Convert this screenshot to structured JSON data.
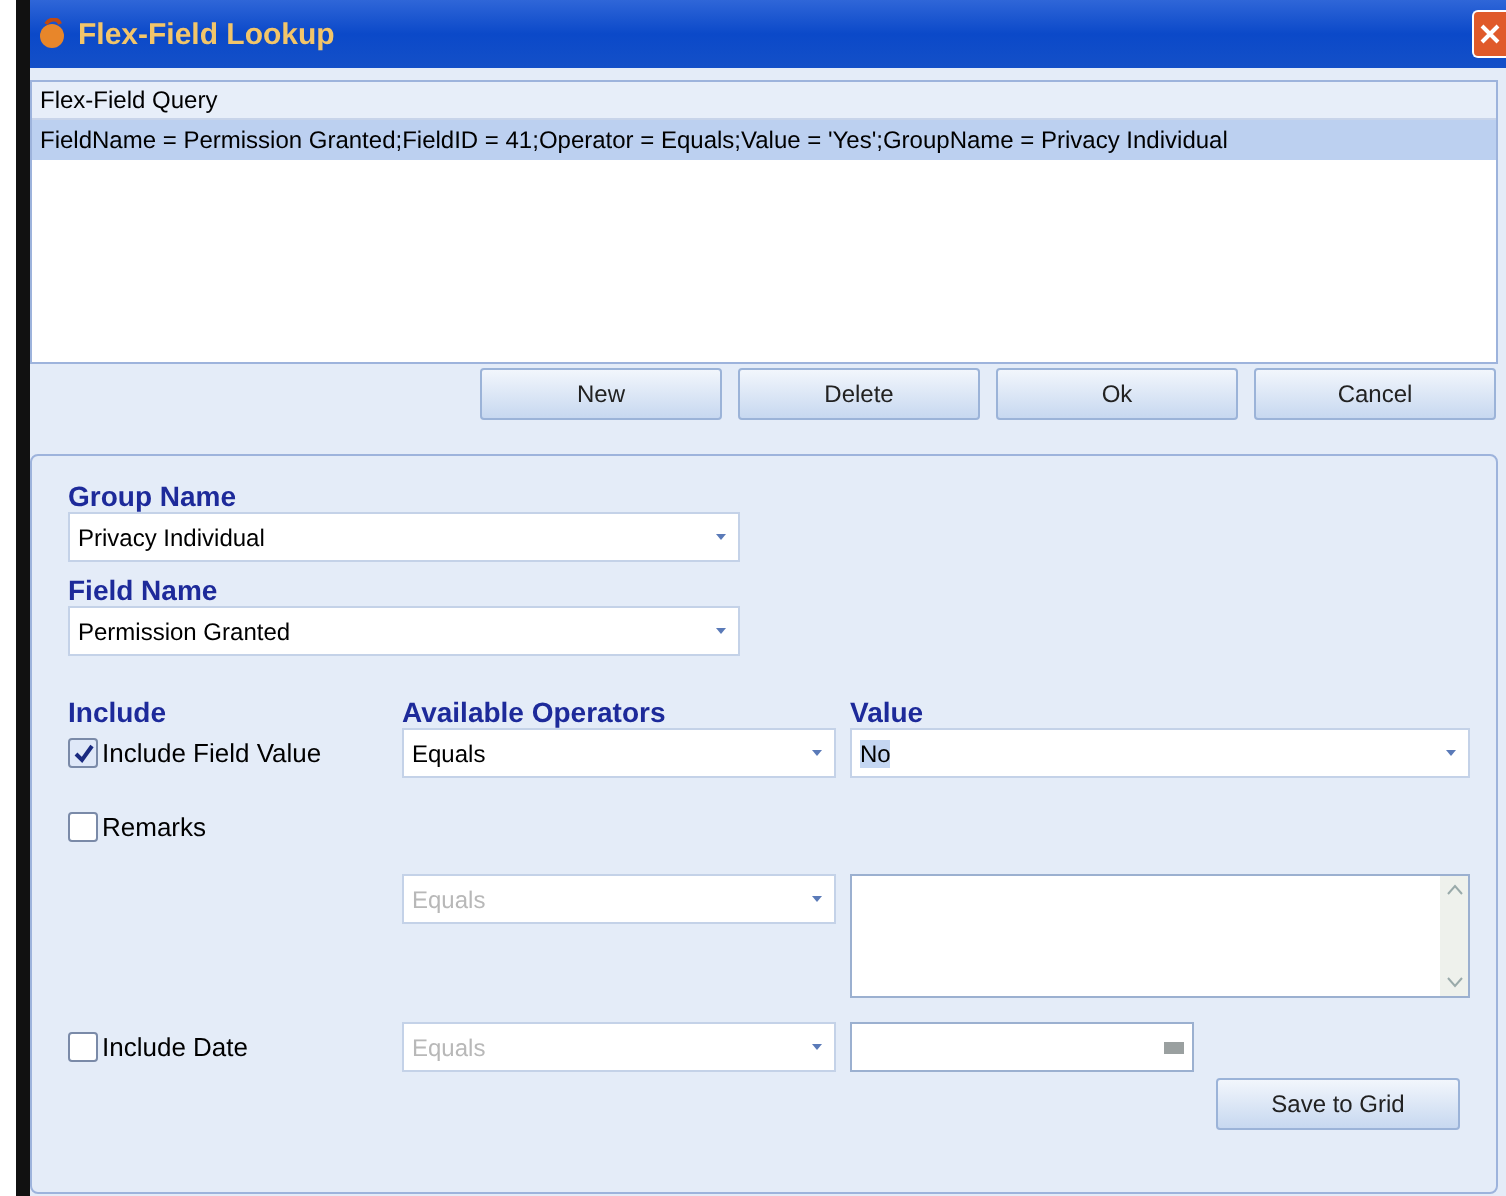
{
  "window": {
    "title": "Flex-Field Lookup"
  },
  "grid": {
    "header": "Flex-Field Query",
    "rows": [
      {
        "text": "FieldName = Permission Granted;FieldID = 41;Operator = Equals;Value = 'Yes';GroupName = Privacy Individual",
        "selected": true
      }
    ]
  },
  "buttons": [
    "New",
    "Delete",
    "Ok",
    "Cancel"
  ],
  "group_name": {
    "label": "Group Name",
    "value": "Privacy Individual"
  },
  "field_name": {
    "label": "Field Name",
    "value": "Permission Granted"
  },
  "headers": {
    "include": "Include",
    "operators": "Available Operators",
    "value": "Value"
  },
  "criteria": [
    {
      "kind": "combo",
      "label": "Include Field Value",
      "checked": true,
      "operator": "Equals",
      "disabled": false,
      "value": "No"
    },
    {
      "kind": "textarea",
      "label": "Remarks",
      "checked": false,
      "operator": "Equals",
      "disabled": true
    },
    {
      "kind": "date",
      "label": "Include Date",
      "checked": false,
      "operator": "Equals",
      "disabled": true
    }
  ],
  "save_button": "Save to Grid"
}
